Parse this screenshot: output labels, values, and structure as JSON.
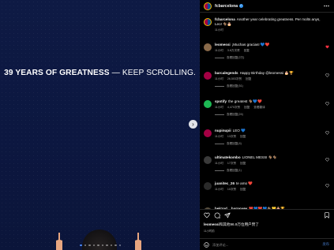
{
  "post": {
    "headline_bold": "39 YEARS OF GREATNESS",
    "headline_rest": " — KEEP SCROLLING.",
    "carousel_total": 10,
    "carousel_active": 1
  },
  "header": {
    "username": "fcbarcelona"
  },
  "caption": {
    "username": "fcbarcelona",
    "text": "Another year celebrating greatness. Per molts anys, Leo! 🐐🎂",
    "time": "11小时"
  },
  "comments": [
    {
      "username": "leomessi",
      "text": "¡Muchas gracias! 💙❤️",
      "time": "11小时",
      "likes": "3.8万次赞",
      "reply": "回复",
      "replies": "查看回复(2万)",
      "heart": "red",
      "avatar": "#8a6a4a"
    },
    {
      "username": "barcalegends",
      "text": "Happy Birthday @leomessi 🎂🏆",
      "time": "11小时",
      "likes": "26,503次赞",
      "reply": "回复",
      "replies": "查看回复(51)",
      "heart": "",
      "avatar": "#a50044"
    },
    {
      "username": "spotify",
      "text": "the greatest 🐐💙❤️",
      "time": "11小时",
      "likes": "4,470次赞",
      "reply": "回复",
      "extra": "查看翻译",
      "replies": "查看回复(24)",
      "heart": "",
      "avatar": "#1db954"
    },
    {
      "username": "nupinupii",
      "text": "LEO 💙",
      "time": "11小时",
      "likes": "13次赞",
      "reply": "回复",
      "replies": "查看回复(4)",
      "heart": "",
      "avatar": "#a50044"
    },
    {
      "username": "ultimatekombo",
      "text": "LIONEL MESSI 🐐🐐",
      "time": "11小时",
      "likes": "17次赞",
      "reply": "回复",
      "replies": "查看回复(1)",
      "heart": "",
      "avatar": "#3a3a3a"
    },
    {
      "username": "juanitec_26",
      "text": "te amo ❤️",
      "time": "11小时",
      "likes": "10次赞",
      "reply": "回复",
      "replies": "",
      "heart": "",
      "avatar": "#2a2a2a"
    },
    {
      "username": "bekzod__barnoyev",
      "text": "❤️💙❤️💙🐐💛🎂🏆",
      "time": "11小时",
      "likes": "9次赞",
      "reply": "回复",
      "replies": "查看回复(2)",
      "heart": "",
      "avatar": "#5a5040"
    }
  ],
  "footer": {
    "likes_user": "leomessi",
    "likes_text": "和其他96.9万位用户赞了",
    "time": "11小时前",
    "comment_placeholder": "添加评论...",
    "post_label": "发布"
  },
  "colors": {
    "like_red": "#ff3040",
    "verified_blue": "#3897f0",
    "media_bg": "#0d1842"
  },
  "icons": [
    "more-options-icon",
    "like-icon",
    "comment-icon",
    "share-icon",
    "save-icon",
    "emoji-icon",
    "next-icon",
    "verified-icon"
  ]
}
